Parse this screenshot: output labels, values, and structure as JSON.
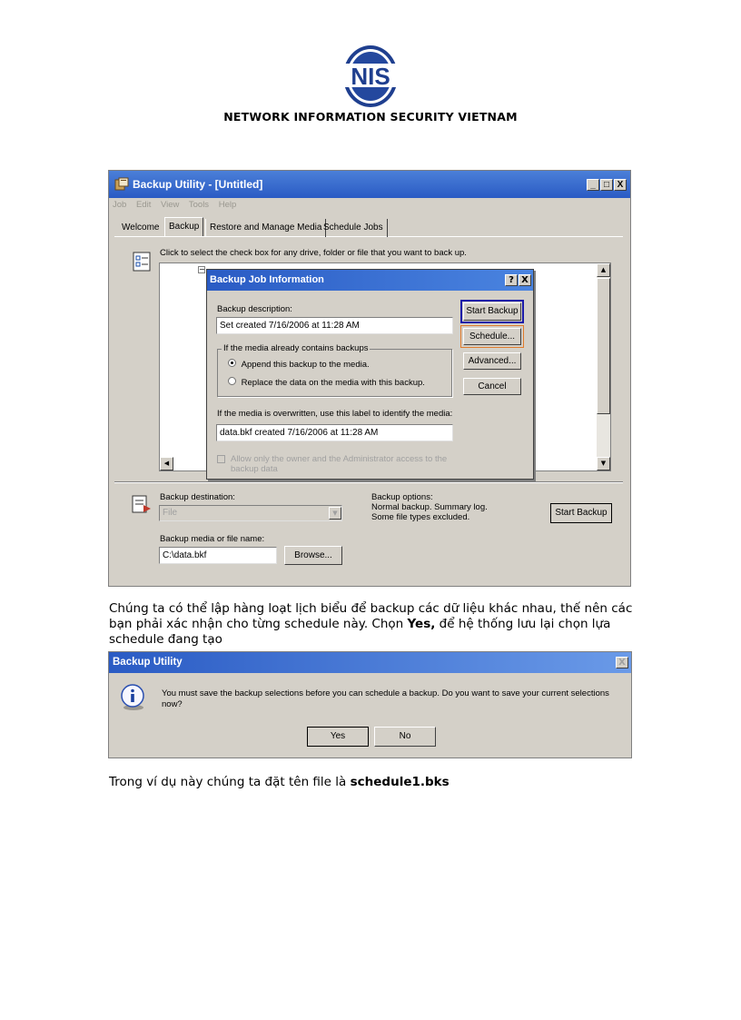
{
  "header": {
    "logo_text": "NIS",
    "company": "NETWORK INFORMATION SECURITY VIETNAM"
  },
  "backup_window": {
    "title": "Backup Utility - [Untitled]",
    "menu": [
      "Job",
      "Edit",
      "View",
      "Tools",
      "Help"
    ],
    "tabs": [
      "Welcome",
      "Backup",
      "Restore and Manage Media",
      "Schedule Jobs"
    ],
    "instruction": "Click to select the check box for any drive, folder or file that you want to back up.",
    "destination_label": "Backup destination:",
    "destination_value": "File",
    "media_label": "Backup media or file name:",
    "media_value": "C:\\data.bkf",
    "browse_label": "Browse...",
    "options_label": "Backup options:",
    "options_line1": "Normal backup.  Summary log.",
    "options_line2": "Some file types excluded.",
    "start_backup_label": "Start Backup",
    "controls": {
      "minimize": "_",
      "maximize": "□",
      "close": "X"
    }
  },
  "job_dialog": {
    "title": "Backup Job Information",
    "help_btn": "?",
    "close_btn": "X",
    "desc_label": "Backup description:",
    "desc_value": "Set created 7/16/2006 at 11:28 AM",
    "group_label": "If the media already contains backups",
    "append_label": "Append this backup to the media.",
    "replace_label": "Replace the data on the media with this backup.",
    "label_prompt": "If the media is overwritten, use this label to identify the media:",
    "label_value": "data.bkf created 7/16/2006 at 11:28 AM",
    "allow_line1": "Allow only the owner and the Administrator access to the",
    "allow_line2": "backup data",
    "start_backup": "Start Backup",
    "schedule": "Schedule...",
    "advanced": "Advanced...",
    "cancel": "Cancel"
  },
  "paragraph": {
    "line1": "Chúng ta có thể lập hàng loạt lịch biểu để backup các dữ liệu khác nhau, thế nên các",
    "line2": "bạn phải xác nhận cho từng schedule này. Chọn ",
    "line2_bold": "Yes,",
    "line2_rest": " để hệ thống lưu lại chọn lựa",
    "line3": "schedule đang tạo"
  },
  "message_box": {
    "title": "Backup Utility",
    "close_btn": "X",
    "message_line1": "You must save the backup selections before you can schedule a backup. Do you want to save your current selections",
    "message_line2": "now?",
    "yes": "Yes",
    "no": "No"
  },
  "footer_text": {
    "prefix": "Trong ví dụ này chúng ta đặt tên file là ",
    "bold": "schedule1.bks"
  },
  "colors": {
    "title_blue": "#2a5bc4",
    "logo_blue": "#1f3f8f",
    "highlight_blue": "#1a1aa8",
    "highlight_orange": "#e07b2c"
  }
}
